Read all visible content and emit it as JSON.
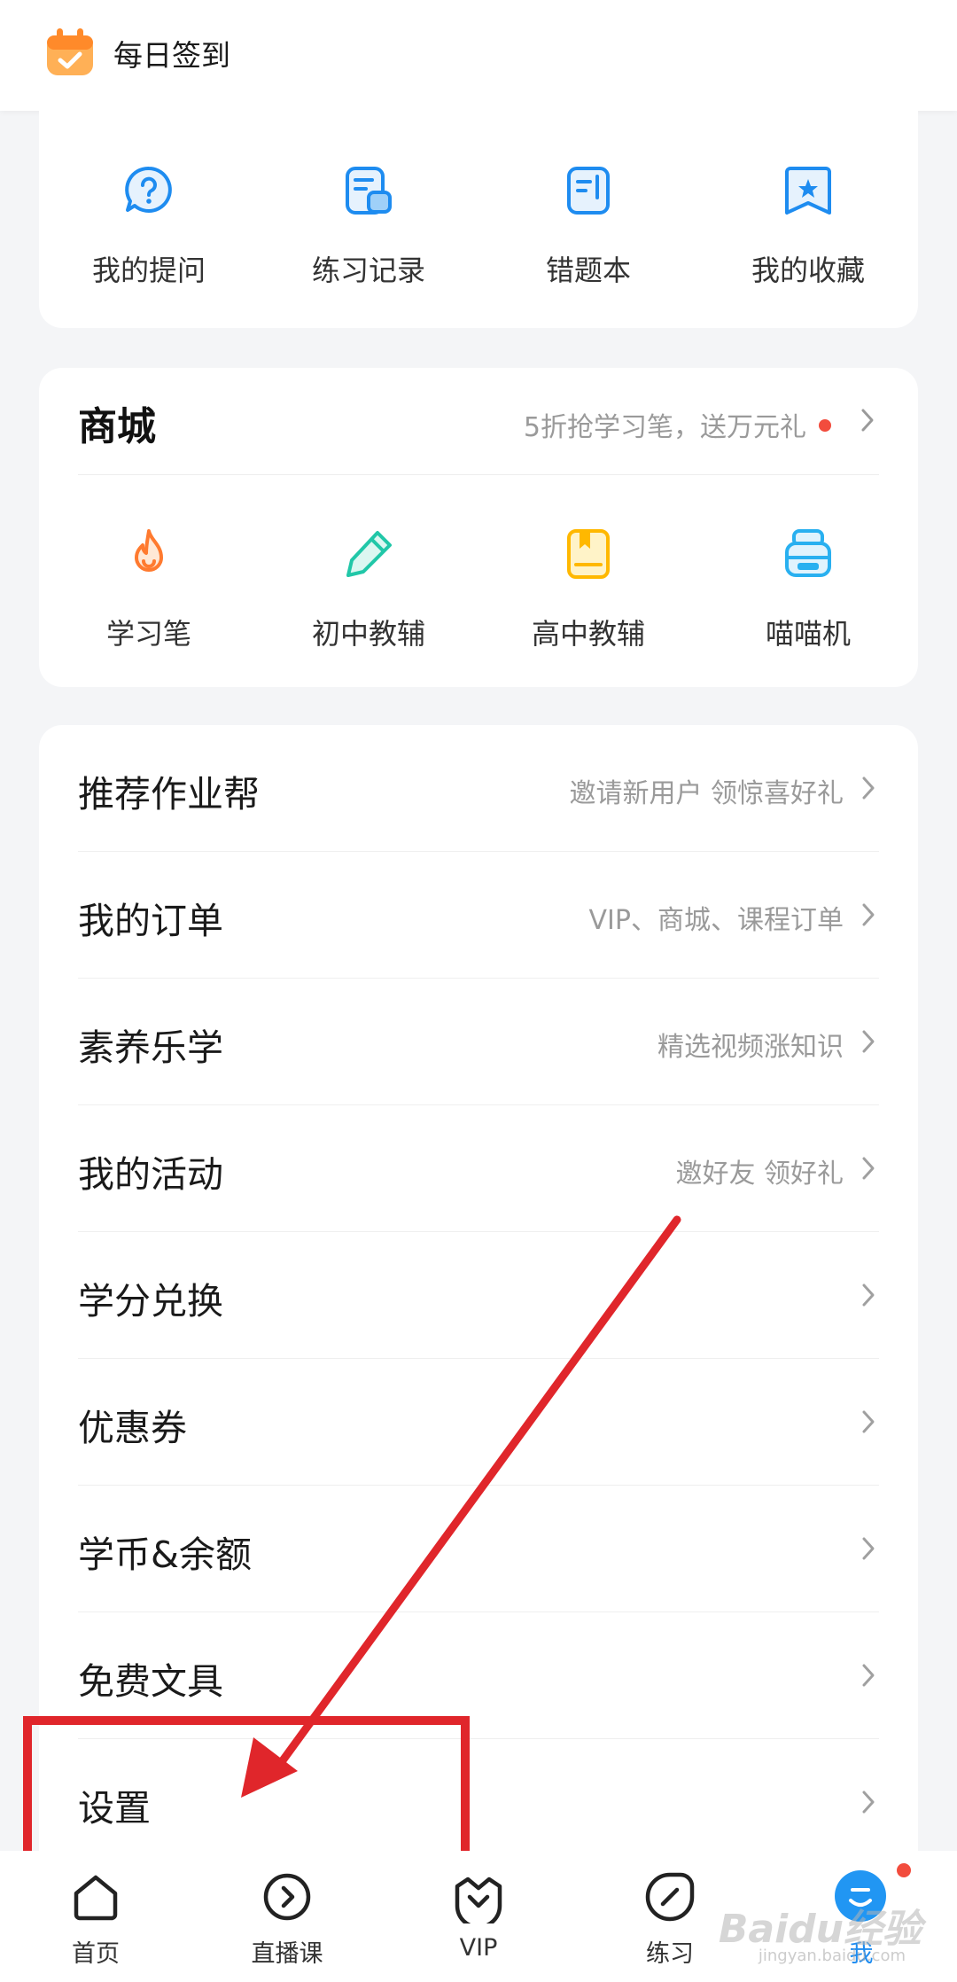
{
  "header": {
    "signin_label": "每日签到"
  },
  "quick_tools": [
    {
      "label": "我的提问",
      "icon": "question-bubble-icon"
    },
    {
      "label": "练习记录",
      "icon": "practice-record-icon"
    },
    {
      "label": "错题本",
      "icon": "wrong-questions-book-icon"
    },
    {
      "label": "我的收藏",
      "icon": "bookmark-star-icon"
    }
  ],
  "shop": {
    "title": "商城",
    "promo": "5折抢学习笔，送万元礼",
    "items": [
      {
        "label": "学习笔",
        "icon": "flame-icon"
      },
      {
        "label": "初中教辅",
        "icon": "pencil-icon"
      },
      {
        "label": "高中教辅",
        "icon": "book-icon"
      },
      {
        "label": "喵喵机",
        "icon": "printer-icon"
      }
    ]
  },
  "menu": [
    {
      "title": "推荐作业帮",
      "hint": "邀请新用户 领惊喜好礼"
    },
    {
      "title": "我的订单",
      "hint": "VIP、商城、课程订单"
    },
    {
      "title": "素养乐学",
      "hint": "精选视频涨知识"
    },
    {
      "title": "我的活动",
      "hint": "邀好友 领好礼"
    },
    {
      "title": "学分兑换",
      "hint": ""
    },
    {
      "title": "优惠券",
      "hint": ""
    },
    {
      "title": "学币&余额",
      "hint": ""
    },
    {
      "title": "免费文具",
      "hint": ""
    },
    {
      "title": "设置",
      "hint": ""
    }
  ],
  "tabs": [
    {
      "label": "首页",
      "icon": "home-icon"
    },
    {
      "label": "直播课",
      "icon": "play-circle-icon"
    },
    {
      "label": "VIP",
      "icon": "vip-crown-icon"
    },
    {
      "label": "练习",
      "icon": "compass-icon"
    },
    {
      "label": "我",
      "icon": "profile-icon"
    }
  ],
  "watermark": {
    "brand": "Baidu经验",
    "url": "jingyan.baidu.com"
  },
  "colors": {
    "accent": "#1e8cf0",
    "annotation_red": "#e0262b",
    "badge_red": "#f24c3d",
    "signin_orange": "#ff9a3c"
  }
}
